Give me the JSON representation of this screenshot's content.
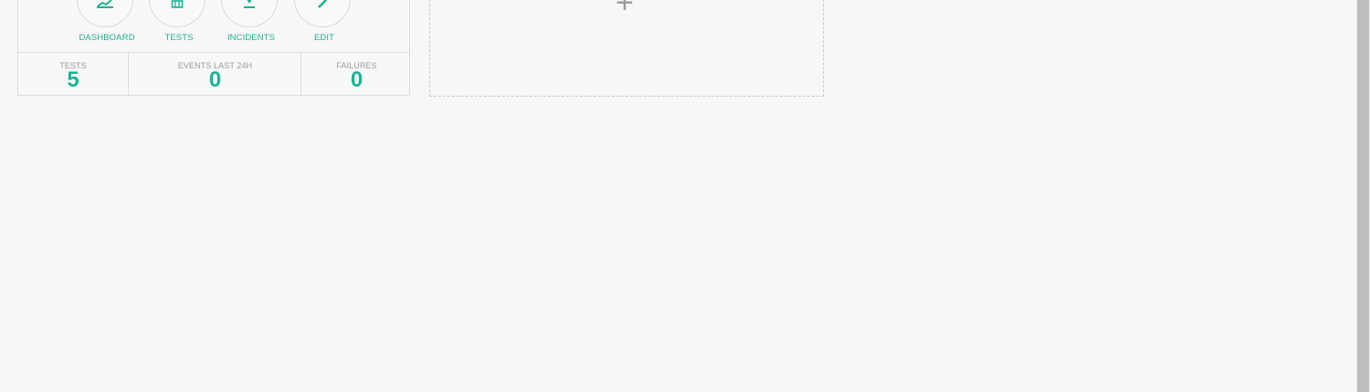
{
  "actions": [
    {
      "label": "DASHBOARD",
      "icon": "chart-line-icon"
    },
    {
      "label": "TESTS",
      "icon": "flask-icon"
    },
    {
      "label": "INCIDENTS",
      "icon": "download-icon"
    },
    {
      "label": "EDIT",
      "icon": "pencil-icon"
    }
  ],
  "stats": [
    {
      "label": "TESTS",
      "value": "5"
    },
    {
      "label": "EVENTS LAST 24H",
      "value": "0"
    },
    {
      "label": "FAILURES",
      "value": "0"
    }
  ],
  "add_card": {
    "symbol": "+"
  },
  "colors": {
    "accent": "#1ab394",
    "muted_text": "#9a9a9a",
    "border": "#dcdcdc",
    "background": "#f7f7f7"
  }
}
